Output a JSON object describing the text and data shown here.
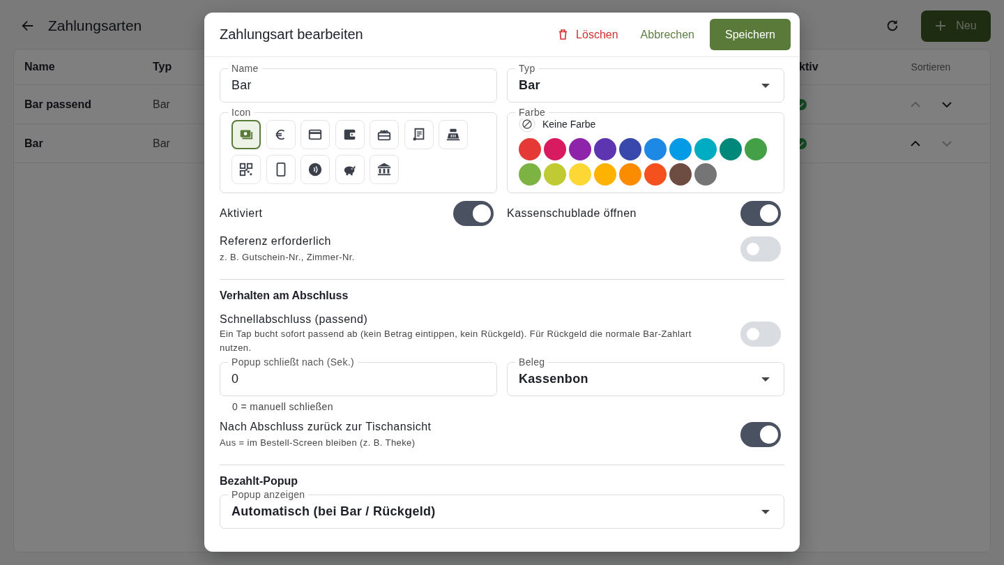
{
  "page": {
    "title": "Zahlungsarten",
    "new_button": "Neu",
    "table": {
      "columns": [
        "Name",
        "Typ",
        "ktiv",
        "Sortieren"
      ],
      "rows": [
        {
          "name": "Bar passend",
          "type": "Bar",
          "active": true,
          "can_move_up": false,
          "can_move_down": true
        },
        {
          "name": "Bar",
          "type": "Bar",
          "active": true,
          "can_move_up": true,
          "can_move_down": false
        }
      ]
    }
  },
  "dialog": {
    "title": "Zahlungsart bearbeiten",
    "delete_button": "Löschen",
    "cancel_button": "Abbrechen",
    "save_button": "Speichern",
    "name_field": {
      "label": "Name",
      "value": "Bar"
    },
    "type_field": {
      "label": "Typ",
      "value": "Bar"
    },
    "icon_picker": {
      "label": "Icon",
      "icons": [
        {
          "kind": "cash",
          "selected": true
        },
        {
          "kind": "euro",
          "selected": false
        },
        {
          "kind": "card",
          "selected": false
        },
        {
          "kind": "wallet",
          "selected": false
        },
        {
          "kind": "gift",
          "selected": false
        },
        {
          "kind": "receipt",
          "selected": false
        },
        {
          "kind": "register",
          "selected": false
        },
        {
          "kind": "qr",
          "selected": false
        },
        {
          "kind": "phone",
          "selected": false
        },
        {
          "kind": "contactless",
          "selected": false
        },
        {
          "kind": "piggy",
          "selected": false
        },
        {
          "kind": "bank",
          "selected": false
        }
      ]
    },
    "color_picker": {
      "label": "Farbe",
      "none_label": "Keine Farbe",
      "none_selected": true,
      "colors": [
        {
          "color": "#e53935",
          "selected": false
        },
        {
          "color": "#d81b60",
          "selected": false
        },
        {
          "color": "#8e24aa",
          "selected": false
        },
        {
          "color": "#5e35b1",
          "selected": false
        },
        {
          "color": "#3949ab",
          "selected": false
        },
        {
          "color": "#1e88e5",
          "selected": false
        },
        {
          "color": "#039be5",
          "selected": false
        },
        {
          "color": "#00acc1",
          "selected": false
        },
        {
          "color": "#00897b",
          "selected": false
        },
        {
          "color": "#43a047",
          "selected": false
        },
        {
          "color": "#7cb342",
          "selected": false
        },
        {
          "color": "#c0ca33",
          "selected": false
        },
        {
          "color": "#fdd835",
          "selected": false
        },
        {
          "color": "#ffb300",
          "selected": false
        },
        {
          "color": "#fb8c00",
          "selected": false
        },
        {
          "color": "#f4511e",
          "selected": false
        },
        {
          "color": "#6d4c41",
          "selected": false
        },
        {
          "color": "#757575",
          "selected": false
        }
      ]
    },
    "pair_toggles": [
      {
        "label": "Aktiviert",
        "on": true
      },
      {
        "label": "Kassenschublade öffnen",
        "on": true
      }
    ],
    "reference_toggle": {
      "label": "Referenz erforderlich",
      "hint": "z. B. Gutschein-Nr., Zimmer-Nr.",
      "on": false
    },
    "closing": {
      "title": "Verhalten am Abschluss",
      "quick_toggle": {
        "label": "Schnellabschluss (passend)",
        "hint": "Ein Tap bucht sofort passend ab (kein Betrag eintippen, kein Rückgeld). Für Rückgeld die normale Bar-Zahlart nutzen.",
        "on": false
      },
      "popup_field": {
        "label": "Popup schließt nach (Sek.)",
        "value": "0",
        "helper": "0 = manuell schließen"
      },
      "receipt_field": {
        "label": "Beleg",
        "value": "Kassenbon"
      },
      "return_toggle": {
        "label": "Nach Abschluss zurück zur Tischansicht",
        "hint": "Aus = im Bestell-Screen bleiben (z. B. Theke)",
        "on": true
      }
    },
    "paid_popup": {
      "title": "Bezahlt-Popup",
      "show_field": {
        "label": "Popup anzeigen",
        "value": "Automatisch (bei Bar / Rückgeld)"
      }
    }
  }
}
